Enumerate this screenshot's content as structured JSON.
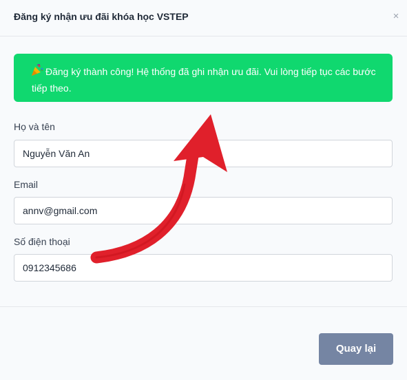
{
  "modal": {
    "title": "Đăng ký nhận ưu đãi khóa học VSTEP",
    "close_icon": "×"
  },
  "alert": {
    "icon": "party-popper-icon",
    "message": "Đăng ký thành công! Hệ thống đã ghi nhận ưu đãi. Vui lòng tiếp tục các bước tiếp theo.",
    "color": "#10d86f"
  },
  "form": {
    "name_label": "Họ và tên",
    "name_value": "Nguyễn Văn An",
    "email_label": "Email",
    "email_value": "annv@gmail.com",
    "phone_label": "Số điện thoại",
    "phone_value": "0912345686"
  },
  "footer": {
    "back_label": "Quay lại",
    "back_color": "#7585a3"
  },
  "annotation": {
    "icon": "red-arrow-icon",
    "color": "#e0202b"
  }
}
